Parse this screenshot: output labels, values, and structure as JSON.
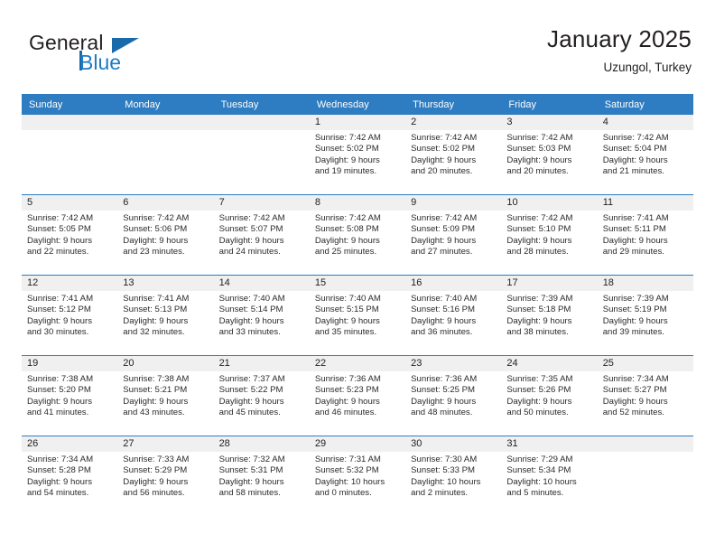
{
  "brand": {
    "name_part1": "General",
    "name_part2": "Blue",
    "logo_icon": "triangle-flag-icon"
  },
  "header": {
    "title": "January 2025",
    "subtitle": "Uzungol, Turkey"
  },
  "calendar": {
    "weekday_headers": [
      "Sunday",
      "Monday",
      "Tuesday",
      "Wednesday",
      "Thursday",
      "Friday",
      "Saturday"
    ],
    "accent_color": "#2e7cc1",
    "daynum_bar_color": "#f0f0f0",
    "weeks": [
      [
        {
          "day": "",
          "lines": []
        },
        {
          "day": "",
          "lines": []
        },
        {
          "day": "",
          "lines": []
        },
        {
          "day": "1",
          "lines": [
            "Sunrise: 7:42 AM",
            "Sunset: 5:02 PM",
            "Daylight: 9 hours",
            "and 19 minutes."
          ]
        },
        {
          "day": "2",
          "lines": [
            "Sunrise: 7:42 AM",
            "Sunset: 5:02 PM",
            "Daylight: 9 hours",
            "and 20 minutes."
          ]
        },
        {
          "day": "3",
          "lines": [
            "Sunrise: 7:42 AM",
            "Sunset: 5:03 PM",
            "Daylight: 9 hours",
            "and 20 minutes."
          ]
        },
        {
          "day": "4",
          "lines": [
            "Sunrise: 7:42 AM",
            "Sunset: 5:04 PM",
            "Daylight: 9 hours",
            "and 21 minutes."
          ]
        }
      ],
      [
        {
          "day": "5",
          "lines": [
            "Sunrise: 7:42 AM",
            "Sunset: 5:05 PM",
            "Daylight: 9 hours",
            "and 22 minutes."
          ]
        },
        {
          "day": "6",
          "lines": [
            "Sunrise: 7:42 AM",
            "Sunset: 5:06 PM",
            "Daylight: 9 hours",
            "and 23 minutes."
          ]
        },
        {
          "day": "7",
          "lines": [
            "Sunrise: 7:42 AM",
            "Sunset: 5:07 PM",
            "Daylight: 9 hours",
            "and 24 minutes."
          ]
        },
        {
          "day": "8",
          "lines": [
            "Sunrise: 7:42 AM",
            "Sunset: 5:08 PM",
            "Daylight: 9 hours",
            "and 25 minutes."
          ]
        },
        {
          "day": "9",
          "lines": [
            "Sunrise: 7:42 AM",
            "Sunset: 5:09 PM",
            "Daylight: 9 hours",
            "and 27 minutes."
          ]
        },
        {
          "day": "10",
          "lines": [
            "Sunrise: 7:42 AM",
            "Sunset: 5:10 PM",
            "Daylight: 9 hours",
            "and 28 minutes."
          ]
        },
        {
          "day": "11",
          "lines": [
            "Sunrise: 7:41 AM",
            "Sunset: 5:11 PM",
            "Daylight: 9 hours",
            "and 29 minutes."
          ]
        }
      ],
      [
        {
          "day": "12",
          "lines": [
            "Sunrise: 7:41 AM",
            "Sunset: 5:12 PM",
            "Daylight: 9 hours",
            "and 30 minutes."
          ]
        },
        {
          "day": "13",
          "lines": [
            "Sunrise: 7:41 AM",
            "Sunset: 5:13 PM",
            "Daylight: 9 hours",
            "and 32 minutes."
          ]
        },
        {
          "day": "14",
          "lines": [
            "Sunrise: 7:40 AM",
            "Sunset: 5:14 PM",
            "Daylight: 9 hours",
            "and 33 minutes."
          ]
        },
        {
          "day": "15",
          "lines": [
            "Sunrise: 7:40 AM",
            "Sunset: 5:15 PM",
            "Daylight: 9 hours",
            "and 35 minutes."
          ]
        },
        {
          "day": "16",
          "lines": [
            "Sunrise: 7:40 AM",
            "Sunset: 5:16 PM",
            "Daylight: 9 hours",
            "and 36 minutes."
          ]
        },
        {
          "day": "17",
          "lines": [
            "Sunrise: 7:39 AM",
            "Sunset: 5:18 PM",
            "Daylight: 9 hours",
            "and 38 minutes."
          ]
        },
        {
          "day": "18",
          "lines": [
            "Sunrise: 7:39 AM",
            "Sunset: 5:19 PM",
            "Daylight: 9 hours",
            "and 39 minutes."
          ]
        }
      ],
      [
        {
          "day": "19",
          "lines": [
            "Sunrise: 7:38 AM",
            "Sunset: 5:20 PM",
            "Daylight: 9 hours",
            "and 41 minutes."
          ]
        },
        {
          "day": "20",
          "lines": [
            "Sunrise: 7:38 AM",
            "Sunset: 5:21 PM",
            "Daylight: 9 hours",
            "and 43 minutes."
          ]
        },
        {
          "day": "21",
          "lines": [
            "Sunrise: 7:37 AM",
            "Sunset: 5:22 PM",
            "Daylight: 9 hours",
            "and 45 minutes."
          ]
        },
        {
          "day": "22",
          "lines": [
            "Sunrise: 7:36 AM",
            "Sunset: 5:23 PM",
            "Daylight: 9 hours",
            "and 46 minutes."
          ]
        },
        {
          "day": "23",
          "lines": [
            "Sunrise: 7:36 AM",
            "Sunset: 5:25 PM",
            "Daylight: 9 hours",
            "and 48 minutes."
          ]
        },
        {
          "day": "24",
          "lines": [
            "Sunrise: 7:35 AM",
            "Sunset: 5:26 PM",
            "Daylight: 9 hours",
            "and 50 minutes."
          ]
        },
        {
          "day": "25",
          "lines": [
            "Sunrise: 7:34 AM",
            "Sunset: 5:27 PM",
            "Daylight: 9 hours",
            "and 52 minutes."
          ]
        }
      ],
      [
        {
          "day": "26",
          "lines": [
            "Sunrise: 7:34 AM",
            "Sunset: 5:28 PM",
            "Daylight: 9 hours",
            "and 54 minutes."
          ]
        },
        {
          "day": "27",
          "lines": [
            "Sunrise: 7:33 AM",
            "Sunset: 5:29 PM",
            "Daylight: 9 hours",
            "and 56 minutes."
          ]
        },
        {
          "day": "28",
          "lines": [
            "Sunrise: 7:32 AM",
            "Sunset: 5:31 PM",
            "Daylight: 9 hours",
            "and 58 minutes."
          ]
        },
        {
          "day": "29",
          "lines": [
            "Sunrise: 7:31 AM",
            "Sunset: 5:32 PM",
            "Daylight: 10 hours",
            "and 0 minutes."
          ]
        },
        {
          "day": "30",
          "lines": [
            "Sunrise: 7:30 AM",
            "Sunset: 5:33 PM",
            "Daylight: 10 hours",
            "and 2 minutes."
          ]
        },
        {
          "day": "31",
          "lines": [
            "Sunrise: 7:29 AM",
            "Sunset: 5:34 PM",
            "Daylight: 10 hours",
            "and 5 minutes."
          ]
        },
        {
          "day": "",
          "lines": []
        }
      ]
    ]
  }
}
